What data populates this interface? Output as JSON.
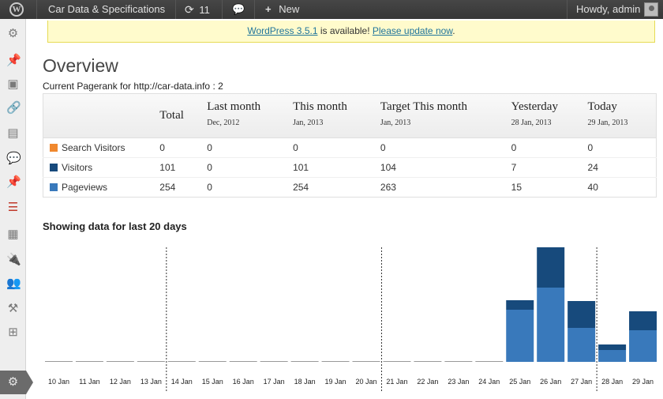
{
  "adminbar": {
    "site_name": "Car Data & Specifications",
    "updates_count": "11",
    "new_label": "New",
    "howdy": "Howdy, admin"
  },
  "notice": {
    "link_version": "WordPress 3.5.1",
    "middle_text": " is available! ",
    "link_update": "Please update now",
    "end_text": "."
  },
  "page": {
    "title": "Overview",
    "pagerank": "Current Pagerank for http://car-data.info : 2"
  },
  "table": {
    "columns": [
      {
        "title": "Total",
        "sub": ""
      },
      {
        "title": "Last month",
        "sub": "Dec, 2012"
      },
      {
        "title": "This month",
        "sub": "Jan, 2013"
      },
      {
        "title": "Target This month",
        "sub": "Jan, 2013"
      },
      {
        "title": "Yesterday",
        "sub": "28 Jan, 2013"
      },
      {
        "title": "Today",
        "sub": "29 Jan, 2013"
      }
    ],
    "rows": [
      {
        "label": "Search Visitors",
        "color": "#f0882e",
        "cells": [
          "0",
          "0",
          "0",
          "0",
          "0",
          "0"
        ]
      },
      {
        "label": "Visitors",
        "color": "#174a7c",
        "cells": [
          "101",
          "0",
          "101",
          "104",
          "7",
          "24"
        ]
      },
      {
        "label": "Pageviews",
        "color": "#3979bb",
        "cells": [
          "254",
          "0",
          "254",
          "263",
          "15",
          "40"
        ]
      }
    ]
  },
  "chart_heading": "Showing data for last 20 days",
  "chart_data": {
    "type": "bar",
    "stacked": true,
    "categories": [
      "10 Jan",
      "11 Jan",
      "12 Jan",
      "13 Jan",
      "14 Jan",
      "15 Jan",
      "16 Jan",
      "17 Jan",
      "18 Jan",
      "19 Jan",
      "20 Jan",
      "21 Jan",
      "22 Jan",
      "23 Jan",
      "24 Jan",
      "25 Jan",
      "26 Jan",
      "27 Jan",
      "28 Jan",
      "29 Jan"
    ],
    "series": [
      {
        "color": "#3979bb",
        "values": [
          0,
          0,
          0,
          0,
          0,
          0,
          0,
          0,
          0,
          0,
          0,
          0,
          0,
          0,
          0,
          66,
          94,
          43,
          15,
          40
        ]
      },
      {
        "color": "#174a7c",
        "values": [
          0,
          0,
          0,
          0,
          0,
          0,
          0,
          0,
          0,
          0,
          0,
          0,
          0,
          0,
          0,
          12,
          51,
          34,
          7,
          24
        ]
      }
    ],
    "week_separators_after": [
      "13 Jan",
      "20 Jan",
      "27 Jan"
    ],
    "ymax": 145
  }
}
